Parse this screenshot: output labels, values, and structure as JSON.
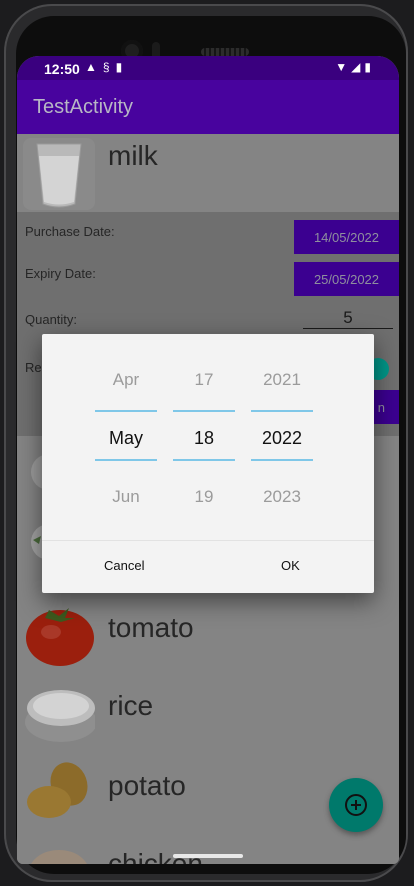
{
  "status_bar": {
    "time": "12:50",
    "left_icons": [
      "warning-icon",
      "sync-icon",
      "sd-card-icon"
    ],
    "right_icons": [
      "wifi-icon",
      "signal-icon",
      "battery-icon"
    ]
  },
  "app_bar": {
    "title": "TestActivity"
  },
  "selected_item": {
    "name": "milk",
    "labels": {
      "purchase_date": "Purchase Date:",
      "expiry_date": "Expiry Date:",
      "quantity": "Quantity:",
      "partial_label": "Re"
    },
    "purchase_date": "14/05/2022",
    "expiry_date": "25/05/2022",
    "quantity": "5",
    "partial_button": "n"
  },
  "products": [
    {
      "name": "tomato",
      "icon": "tomato-icon"
    },
    {
      "name": "rice",
      "icon": "rice-icon"
    },
    {
      "name": "potato",
      "icon": "potato-icon"
    },
    {
      "name": "chicken",
      "icon": "chicken-icon"
    }
  ],
  "date_picker": {
    "month": {
      "prev": "Apr",
      "current": "May",
      "next": "Jun"
    },
    "day": {
      "prev": "17",
      "current": "18",
      "next": "19"
    },
    "year": {
      "prev": "2021",
      "current": "2022",
      "next": "2023"
    },
    "cancel_label": "Cancel",
    "ok_label": "OK"
  },
  "colors": {
    "primary": "#48039e",
    "primary_dark": "#3a007f",
    "accent": "#009688",
    "picker_line": "#7fc7e8"
  }
}
